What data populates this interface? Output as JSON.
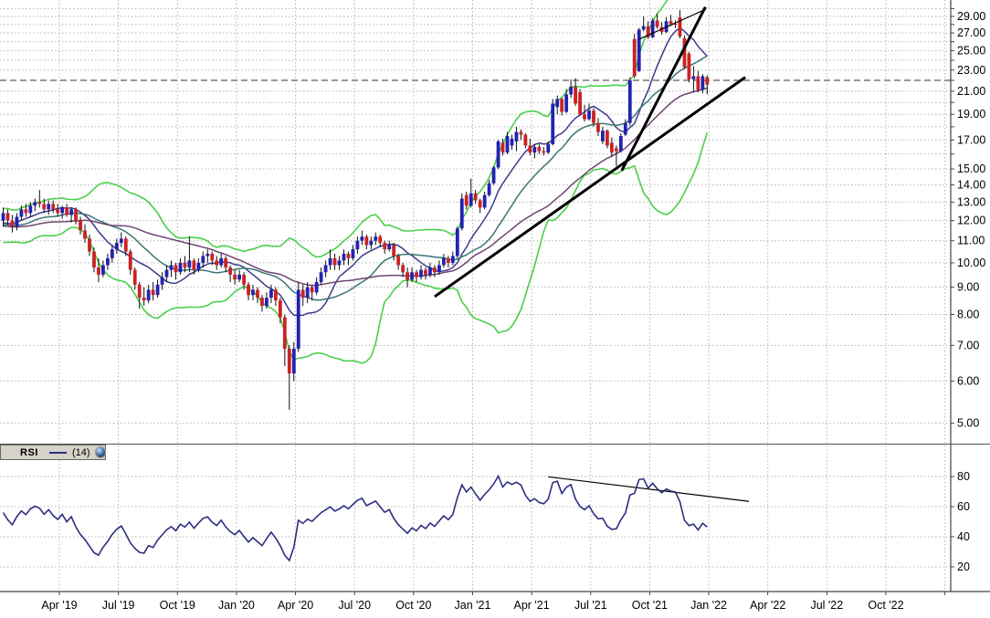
{
  "chart_data": {
    "type": "candlestick",
    "interval": "weekly",
    "description": "Weekly OHLC price chart with Bollinger Bands, 3 moving averages, trendlines, dashed price level at 22.00, and RSI(14) sub-panel",
    "price_axis": {
      "scale": "log",
      "tick_values": [
        29,
        27,
        25,
        23,
        21,
        19,
        17,
        15,
        14,
        13,
        12,
        11,
        10,
        9,
        8,
        7,
        6,
        5
      ],
      "tick_labels": [
        "29.00",
        "27.00",
        "25.00",
        "23.00",
        "21.00",
        "19.00",
        "17.00",
        "15.00",
        "14.00",
        "13.00",
        "12.00",
        "11.00",
        "10.00",
        "9.00",
        "8.00",
        "7.00",
        "6.00",
        "5.00"
      ],
      "gridline_min": 5,
      "gridline_max": 30,
      "gridline_step": 1
    },
    "time_axis": {
      "labels": [
        "Apr '19",
        "Jul '19",
        "Oct '19",
        "Jan '20",
        "Apr '20",
        "Jul '20",
        "Oct '20",
        "Jan '21",
        "Apr '21",
        "Jul '21",
        "Oct '21",
        "Jan '22",
        "Apr '22",
        "Jul '22",
        "Oct '22"
      ],
      "gridline_count": 16
    },
    "level_line": {
      "price": 22.0
    },
    "candles_ohlc": [
      [
        12.0,
        12.7,
        11.7,
        12.4
      ],
      [
        12.4,
        12.6,
        11.8,
        12.0
      ],
      [
        12.0,
        12.3,
        11.4,
        11.7
      ],
      [
        11.7,
        12.4,
        11.5,
        12.2
      ],
      [
        12.2,
        12.8,
        12.0,
        12.6
      ],
      [
        12.6,
        12.9,
        12.2,
        12.4
      ],
      [
        12.4,
        13.0,
        12.2,
        12.8
      ],
      [
        12.8,
        13.2,
        12.5,
        13.0
      ],
      [
        13.0,
        13.7,
        12.7,
        12.9
      ],
      [
        12.9,
        13.2,
        12.4,
        12.6
      ],
      [
        12.6,
        13.1,
        12.3,
        12.9
      ],
      [
        12.9,
        13.1,
        12.4,
        12.6
      ],
      [
        12.6,
        12.9,
        12.2,
        12.4
      ],
      [
        12.4,
        12.8,
        12.1,
        12.7
      ],
      [
        12.7,
        12.9,
        12.2,
        12.3
      ],
      [
        12.3,
        12.7,
        11.9,
        12.6
      ],
      [
        12.6,
        12.7,
        11.8,
        12.0
      ],
      [
        12.0,
        12.2,
        11.3,
        11.5
      ],
      [
        11.5,
        11.8,
        10.9,
        11.1
      ],
      [
        11.1,
        11.3,
        10.3,
        10.5
      ],
      [
        10.5,
        10.7,
        9.6,
        9.8
      ],
      [
        9.8,
        10.2,
        9.2,
        9.5
      ],
      [
        9.5,
        10.1,
        9.4,
        9.9
      ],
      [
        9.9,
        10.4,
        9.7,
        10.2
      ],
      [
        10.2,
        10.8,
        10.0,
        10.6
      ],
      [
        10.6,
        11.1,
        10.4,
        10.9
      ],
      [
        10.9,
        11.4,
        10.7,
        11.1
      ],
      [
        11.1,
        11.2,
        10.3,
        10.5
      ],
      [
        10.5,
        10.6,
        9.5,
        9.7
      ],
      [
        9.7,
        9.8,
        8.9,
        9.1
      ],
      [
        9.1,
        9.2,
        8.2,
        8.6
      ],
      [
        8.6,
        9.0,
        8.3,
        8.5
      ],
      [
        8.5,
        9.1,
        8.4,
        8.9
      ],
      [
        8.9,
        9.2,
        8.5,
        8.7
      ],
      [
        8.7,
        9.3,
        8.6,
        9.1
      ],
      [
        9.1,
        9.6,
        8.9,
        9.4
      ],
      [
        9.4,
        9.9,
        9.2,
        9.7
      ],
      [
        9.7,
        10.1,
        9.4,
        9.9
      ],
      [
        9.9,
        10.0,
        9.3,
        9.6
      ],
      [
        9.6,
        10.2,
        9.5,
        10.0
      ],
      [
        10.0,
        10.3,
        9.6,
        9.8
      ],
      [
        9.8,
        11.2,
        9.6,
        10.1
      ],
      [
        10.1,
        10.2,
        9.5,
        9.7
      ],
      [
        9.7,
        10.2,
        9.6,
        10.0
      ],
      [
        10.0,
        10.5,
        9.8,
        10.3
      ],
      [
        10.3,
        10.6,
        10.0,
        10.4
      ],
      [
        10.4,
        10.5,
        9.9,
        10.1
      ],
      [
        10.1,
        10.3,
        9.7,
        9.9
      ],
      [
        9.9,
        10.4,
        9.8,
        10.2
      ],
      [
        10.2,
        10.3,
        9.6,
        9.8
      ],
      [
        9.8,
        9.9,
        9.2,
        9.5
      ],
      [
        9.5,
        9.7,
        9.1,
        9.3
      ],
      [
        9.3,
        9.7,
        9.2,
        9.5
      ],
      [
        9.5,
        9.6,
        8.9,
        9.1
      ],
      [
        9.1,
        9.2,
        8.5,
        8.7
      ],
      [
        8.7,
        9.1,
        8.5,
        8.9
      ],
      [
        8.9,
        9.0,
        8.4,
        8.6
      ],
      [
        8.6,
        8.7,
        8.1,
        8.3
      ],
      [
        8.3,
        8.8,
        8.2,
        8.6
      ],
      [
        8.6,
        9.1,
        8.4,
        8.9
      ],
      [
        8.9,
        9.0,
        8.3,
        8.5
      ],
      [
        8.5,
        8.6,
        7.7,
        7.9
      ],
      [
        7.9,
        8.0,
        6.4,
        6.9
      ],
      [
        6.9,
        7.0,
        5.3,
        6.2
      ],
      [
        6.2,
        7.1,
        6.0,
        6.9
      ],
      [
        6.9,
        9.2,
        6.8,
        8.9
      ],
      [
        8.9,
        9.1,
        8.3,
        8.6
      ],
      [
        8.6,
        9.2,
        8.4,
        9.0
      ],
      [
        9.0,
        9.1,
        8.5,
        8.8
      ],
      [
        8.8,
        9.4,
        8.7,
        9.2
      ],
      [
        9.2,
        9.8,
        9.1,
        9.6
      ],
      [
        9.6,
        10.1,
        9.4,
        9.9
      ],
      [
        9.9,
        10.6,
        9.7,
        10.2
      ],
      [
        10.2,
        10.4,
        9.7,
        9.9
      ],
      [
        9.9,
        10.3,
        9.7,
        10.1
      ],
      [
        10.1,
        10.6,
        9.9,
        10.4
      ],
      [
        10.4,
        10.5,
        9.9,
        10.2
      ],
      [
        10.2,
        10.8,
        10.1,
        10.6
      ],
      [
        10.6,
        11.2,
        10.4,
        11.0
      ],
      [
        11.0,
        11.5,
        10.8,
        11.2
      ],
      [
        11.2,
        11.3,
        10.6,
        10.8
      ],
      [
        10.8,
        11.2,
        10.6,
        11.0
      ],
      [
        11.0,
        11.4,
        10.8,
        11.2
      ],
      [
        11.2,
        11.3,
        10.7,
        10.9
      ],
      [
        10.9,
        11.0,
        10.4,
        10.6
      ],
      [
        10.6,
        11.0,
        10.5,
        10.8
      ],
      [
        10.8,
        10.9,
        10.1,
        10.3
      ],
      [
        10.3,
        10.4,
        9.7,
        9.9
      ],
      [
        9.9,
        10.0,
        9.4,
        9.6
      ],
      [
        9.6,
        9.8,
        9.0,
        9.3
      ],
      [
        9.3,
        9.8,
        9.2,
        9.6
      ],
      [
        9.6,
        9.7,
        9.2,
        9.4
      ],
      [
        9.4,
        9.9,
        9.3,
        9.7
      ],
      [
        9.7,
        9.8,
        9.3,
        9.5
      ],
      [
        9.5,
        10.0,
        9.4,
        9.8
      ],
      [
        9.8,
        9.9,
        9.4,
        9.6
      ],
      [
        9.6,
        10.1,
        9.5,
        9.9
      ],
      [
        9.9,
        10.4,
        9.8,
        10.2
      ],
      [
        10.2,
        10.3,
        9.8,
        10.0
      ],
      [
        10.0,
        10.5,
        9.9,
        10.3
      ],
      [
        10.3,
        11.7,
        10.2,
        11.6
      ],
      [
        11.6,
        13.5,
        11.5,
        13.2
      ],
      [
        13.4,
        13.6,
        12.6,
        12.8
      ],
      [
        12.8,
        14.4,
        12.7,
        13.5
      ],
      [
        13.5,
        13.7,
        12.9,
        13.1
      ],
      [
        13.1,
        13.2,
        12.4,
        12.7
      ],
      [
        12.7,
        13.6,
        12.6,
        13.4
      ],
      [
        13.4,
        14.3,
        13.3,
        14.1
      ],
      [
        14.1,
        15.2,
        14.0,
        15.1
      ],
      [
        15.1,
        17.0,
        15.0,
        16.9
      ],
      [
        16.8,
        17.1,
        15.9,
        16.1
      ],
      [
        16.1,
        17.6,
        16.0,
        17.3
      ],
      [
        16.6,
        17.4,
        16.3,
        17.1
      ],
      [
        16.9,
        18.0,
        16.2,
        17.6
      ],
      [
        17.6,
        17.8,
        17.0,
        17.4
      ],
      [
        17.4,
        17.5,
        16.4,
        16.6
      ],
      [
        16.6,
        17.1,
        15.9,
        16.1
      ],
      [
        16.1,
        16.7,
        15.7,
        16.5
      ],
      [
        16.5,
        16.7,
        16.0,
        16.2
      ],
      [
        16.2,
        16.5,
        15.9,
        16.1
      ],
      [
        16.1,
        16.9,
        16.0,
        16.7
      ],
      [
        16.7,
        20.3,
        16.6,
        19.9
      ],
      [
        19.6,
        20.6,
        19.0,
        20.3
      ],
      [
        20.3,
        20.4,
        18.9,
        19.2
      ],
      [
        19.2,
        21.2,
        19.1,
        20.7
      ],
      [
        20.7,
        22.1,
        20.4,
        21.4
      ],
      [
        21.4,
        22.2,
        19.7,
        19.9
      ],
      [
        20.9,
        21.2,
        18.9,
        19.0
      ],
      [
        19.0,
        19.8,
        18.4,
        18.6
      ],
      [
        18.6,
        19.9,
        18.5,
        19.3
      ],
      [
        19.3,
        19.5,
        18.0,
        18.3
      ],
      [
        18.3,
        18.7,
        17.3,
        17.6
      ],
      [
        16.9,
        18.0,
        16.7,
        17.7
      ],
      [
        17.7,
        17.8,
        16.4,
        16.6
      ],
      [
        16.8,
        17.2,
        15.8,
        16.1
      ],
      [
        16.4,
        16.6,
        15.2,
        16.2
      ],
      [
        16.2,
        17.5,
        16.1,
        17.3
      ],
      [
        17.4,
        18.6,
        17.3,
        18.3
      ],
      [
        18.3,
        22.3,
        18.1,
        22.0
      ],
      [
        26.3,
        26.9,
        22.2,
        22.4
      ],
      [
        22.9,
        27.6,
        22.8,
        27.4
      ],
      [
        27.4,
        29.0,
        27.2,
        27.8
      ],
      [
        27.8,
        28.4,
        26.3,
        26.5
      ],
      [
        26.5,
        28.8,
        26.4,
        28.5
      ],
      [
        28.5,
        29.4,
        27.5,
        27.7
      ],
      [
        27.7,
        28.3,
        26.8,
        27.1
      ],
      [
        27.1,
        28.9,
        27.0,
        28.4
      ],
      [
        28.4,
        29.2,
        27.8,
        28.1
      ],
      [
        28.1,
        28.5,
        27.6,
        28.0
      ],
      [
        28.9,
        29.8,
        26.4,
        26.6
      ],
      [
        26.4,
        26.7,
        23.1,
        23.3
      ],
      [
        24.7,
        24.9,
        21.8,
        22.1
      ],
      [
        22.1,
        23.4,
        20.9,
        22.4
      ],
      [
        22.4,
        22.9,
        20.9,
        21.1
      ],
      [
        21.1,
        22.6,
        20.8,
        22.4
      ],
      [
        22.3,
        22.5,
        20.7,
        21.6
      ]
    ],
    "indicator_warmup_closes": [
      12.6,
      12.4,
      12.7,
      12.2,
      11.8,
      12.0,
      11.5,
      11.2,
      10.8,
      11.0,
      11.4,
      11.8,
      12.2,
      12.5,
      12.1,
      11.7,
      11.3,
      10.9,
      10.6,
      11.1,
      11.6,
      12.0,
      12.4,
      12.2,
      11.8,
      11.5,
      11.1,
      10.8,
      11.2,
      11.7,
      12.1,
      12.3,
      11.9,
      11.6,
      11.3,
      11.6,
      11.9,
      12.1,
      11.8,
      12.0
    ],
    "overlays": {
      "bollinger": {
        "period": 20,
        "stddev": 2
      },
      "sma_fast": {
        "period": 10
      },
      "sma_mid": {
        "period": 20
      },
      "sma_slow": {
        "period": 40
      }
    },
    "trendlines": [
      {
        "panel": "price",
        "w1": 95.0,
        "v1": 8.64,
        "w2": 163.4,
        "v2": 22.3,
        "width": 3
      },
      {
        "panel": "price",
        "w1": 136.2,
        "v1": 14.9,
        "w2": 154.6,
        "v2": 30.2,
        "width": 3
      },
      {
        "panel": "price",
        "w1": 140.1,
        "v1": 26.3,
        "w2": 154.8,
        "v2": 29.95,
        "width": 1.2
      },
      {
        "panel": "rsi",
        "w1": 120.0,
        "v1": 79.8,
        "w2": 164.2,
        "v2": 63.5,
        "width": 1.2
      }
    ],
    "rsi": {
      "label": "RSI",
      "params": "(14)",
      "period": 14,
      "tick_values": [
        80,
        60,
        40,
        20
      ],
      "tick_labels": [
        "80",
        "60",
        "40",
        "20"
      ]
    }
  },
  "colors": {
    "background": "#ffffff",
    "grid": "#b4b4b4",
    "axis": "#444444",
    "candle_up": "#2222b2",
    "candle_down": "#cc2222",
    "wick": "#111111",
    "bollinger": "#4ad04a",
    "sma_fast": "#3b3b8c",
    "sma_mid": "#3a7575",
    "sma_slow": "#6e4472",
    "rsi_line": "#2e2e7f",
    "trendline": "#000000",
    "level_line": "#8a8a8a"
  }
}
